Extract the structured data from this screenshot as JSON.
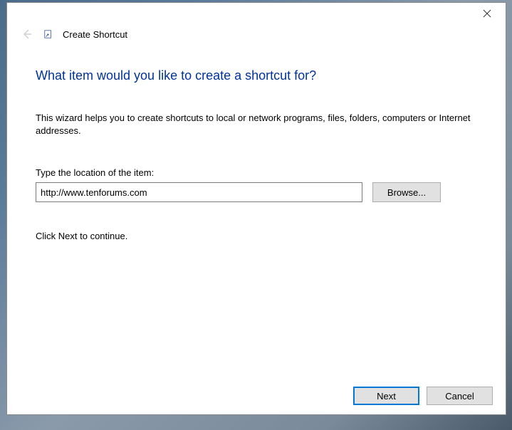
{
  "header": {
    "title": "Create Shortcut"
  },
  "main": {
    "heading": "What item would you like to create a shortcut for?",
    "description": "This wizard helps you to create shortcuts to local or network programs, files, folders, computers or Internet addresses.",
    "field_label": "Type the location of the item:",
    "location_value": "http://www.tenforums.com",
    "browse_label": "Browse...",
    "continue_text": "Click Next to continue."
  },
  "footer": {
    "next_label": "Next",
    "cancel_label": "Cancel"
  }
}
